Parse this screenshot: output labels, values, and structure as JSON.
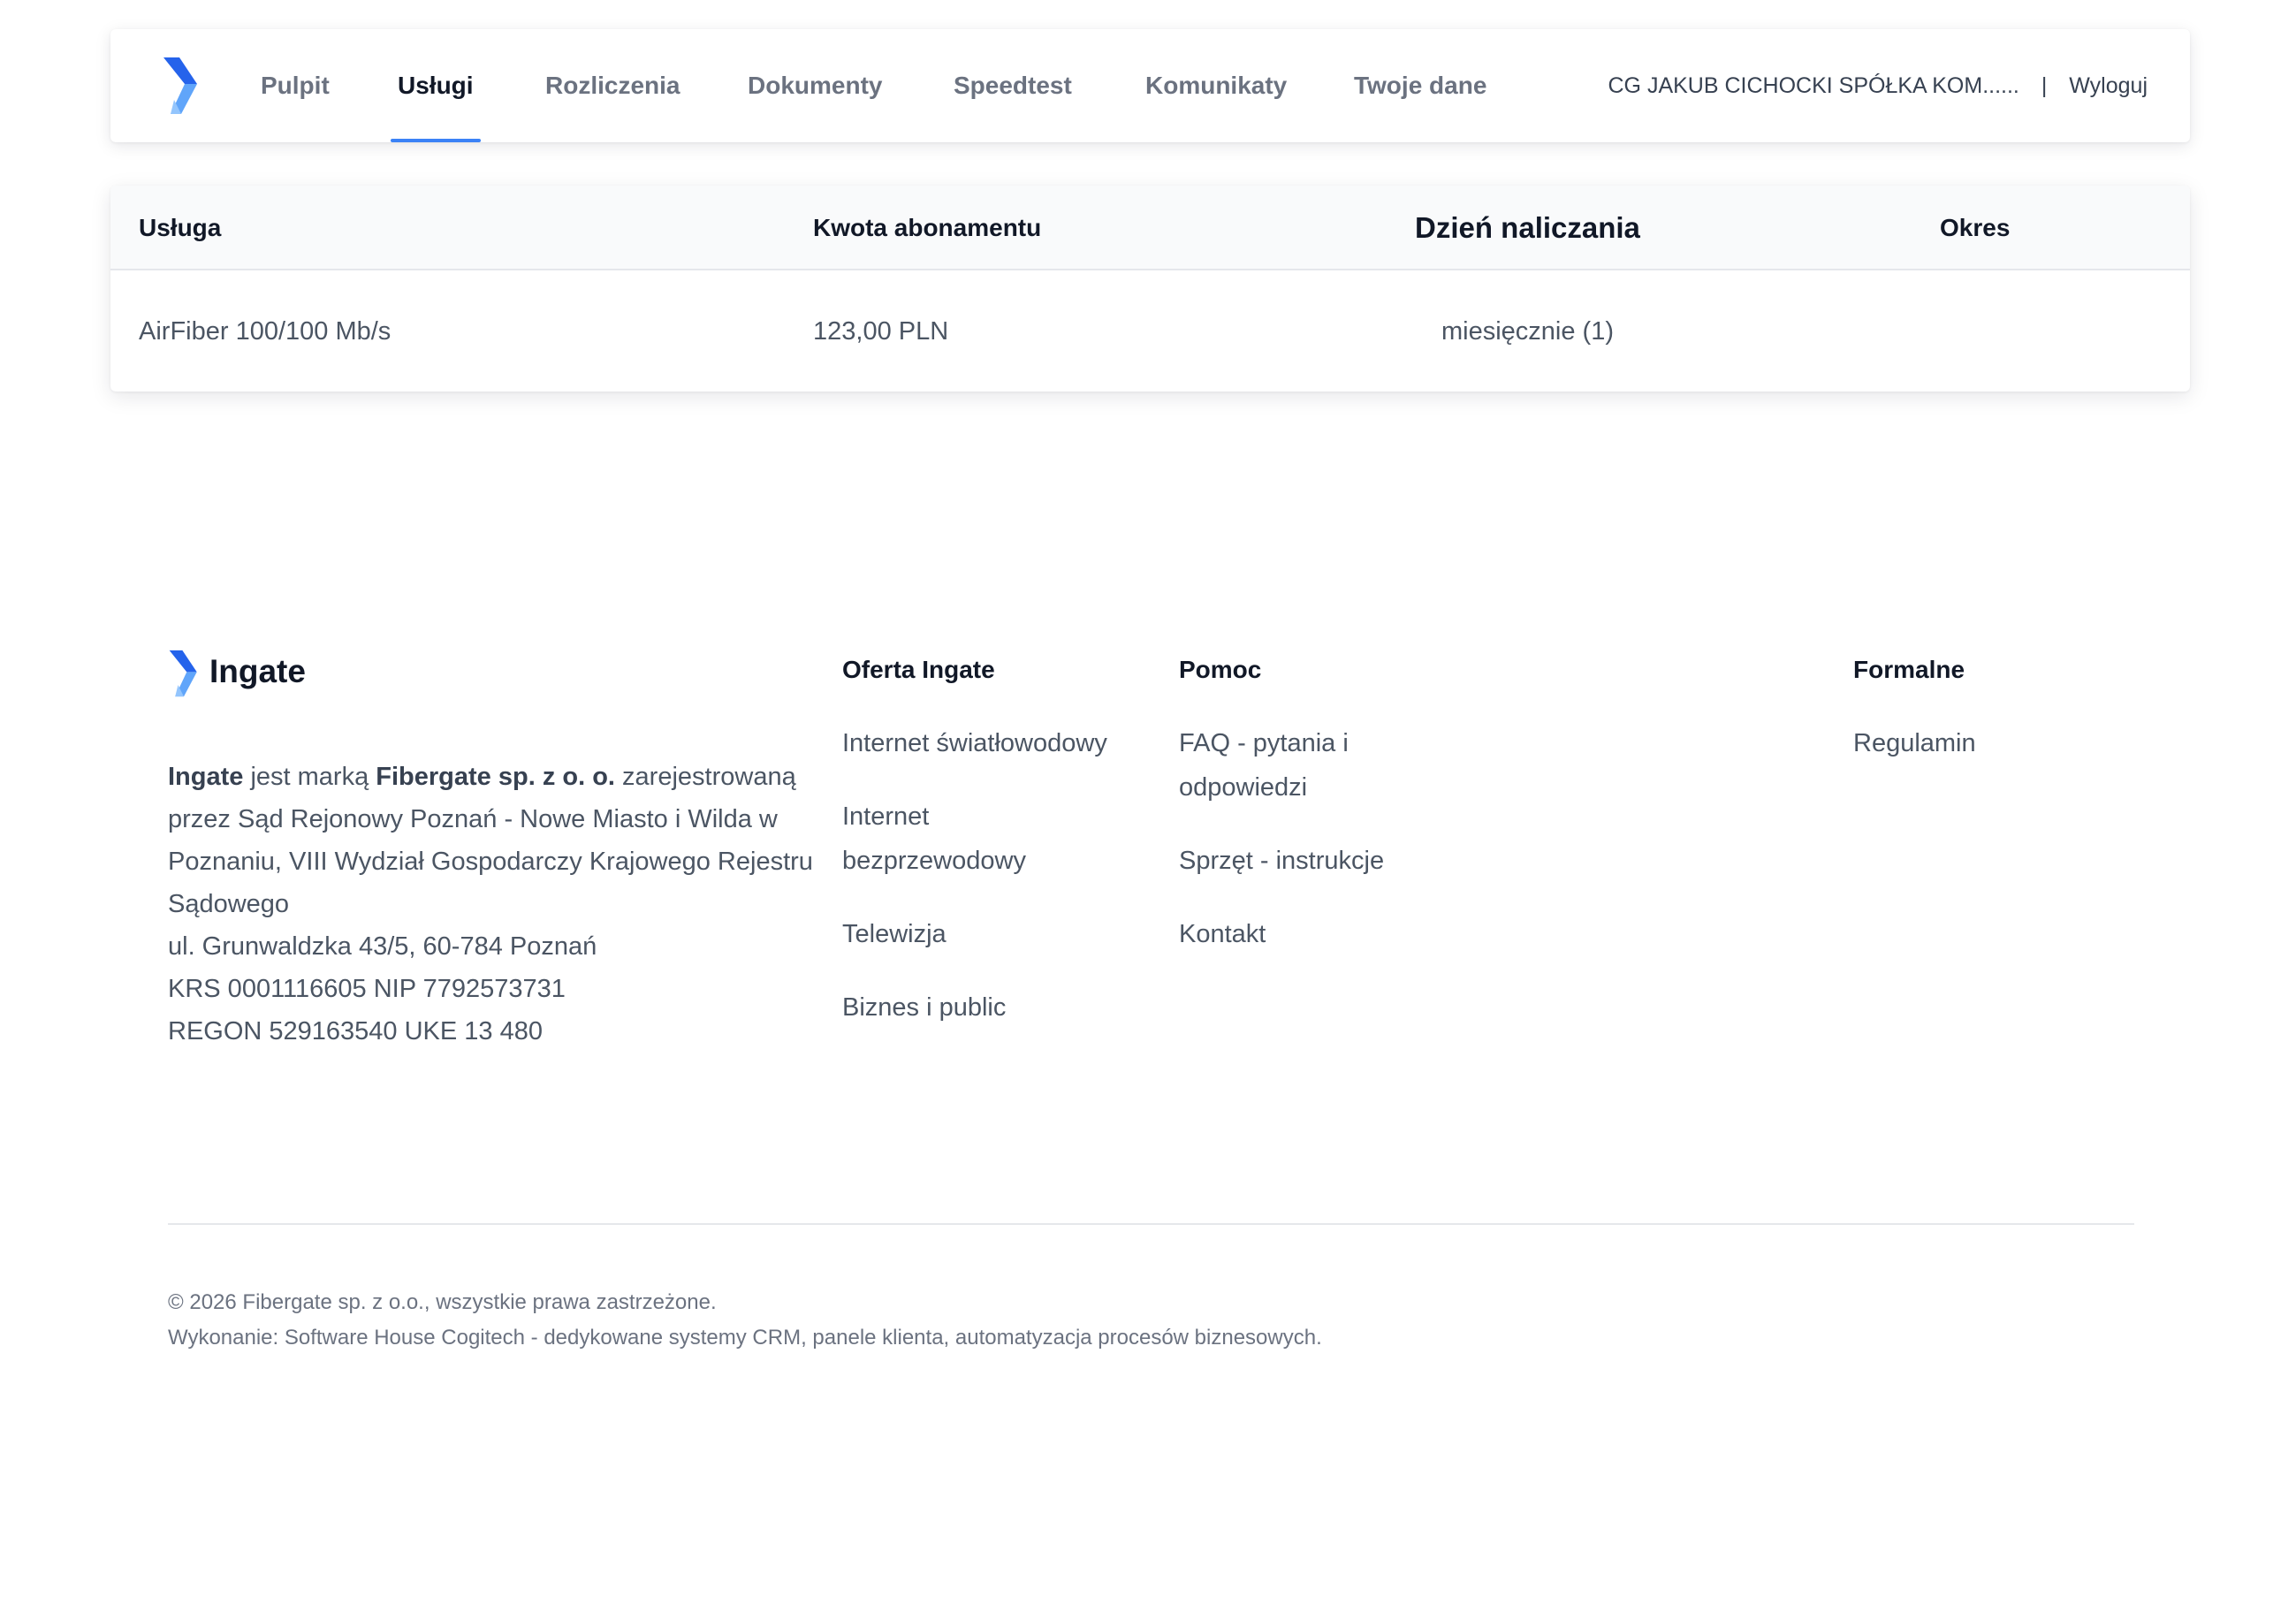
{
  "nav": {
    "tabs": [
      {
        "label": "Pulpit",
        "active": false
      },
      {
        "label": "Usługi",
        "active": true
      },
      {
        "label": "Rozliczenia",
        "active": false
      },
      {
        "label": "Dokumenty",
        "active": false
      },
      {
        "label": "Speedtest",
        "active": false
      },
      {
        "label": "Komunikaty",
        "active": false
      },
      {
        "label": "Twoje dane",
        "active": false
      }
    ],
    "user_name": "CG JAKUB CICHOCKI SPÓŁKA KOM......",
    "separator": "|",
    "logout_label": "Wyloguj"
  },
  "services_table": {
    "columns": [
      "Usługa",
      "Kwota abonamentu",
      "Dzień naliczania",
      "Okres"
    ],
    "rows": [
      {
        "service": "AirFiber 100/100 Mb/s",
        "amount": "123,00 PLN",
        "billing_day": "miesięcznie (1)",
        "period": ""
      }
    ]
  },
  "footer": {
    "brand_name": "Ingate",
    "company": {
      "brand_bold": "Ingate",
      "text_1": " jest marką ",
      "company_bold": "Fibergate sp. z o. o.",
      "text_2": " zarejestrowaną przez Sąd Rejonowy Poznań - Nowe Miasto i Wilda w Poznaniu, VIII Wydział Gospodarczy Krajowego Rejestru Sądowego",
      "address": "ul. Grunwaldzka 43/5, 60-784 Poznań",
      "krs_nip": "KRS 0001116605 NIP 7792573731",
      "regon_uke": "REGON 529163540 UKE 13 480"
    },
    "columns": [
      {
        "title": "Oferta Ingate",
        "links": [
          "Internet światłowodowy",
          "Internet bezprzewodowy",
          "Telewizja",
          "Biznes i public"
        ]
      },
      {
        "title": "Pomoc",
        "links": [
          "FAQ - pytania i odpowiedzi",
          "Sprzęt - instrukcje",
          "Kontakt"
        ]
      },
      {
        "title": "Formalne",
        "links": [
          "Regulamin"
        ]
      }
    ],
    "copyright": "© 2026 Fibergate sp. z o.o., wszystkie prawa zastrzeżone.",
    "credits": "Wykonanie: Software House Cogitech - dedykowane systemy CRM, panele klienta, automatyzacja procesów biznesowych."
  },
  "colors": {
    "accent": "#3b82f6",
    "logo_dark": "#1d4ed8",
    "logo_light": "#60a5fa"
  }
}
